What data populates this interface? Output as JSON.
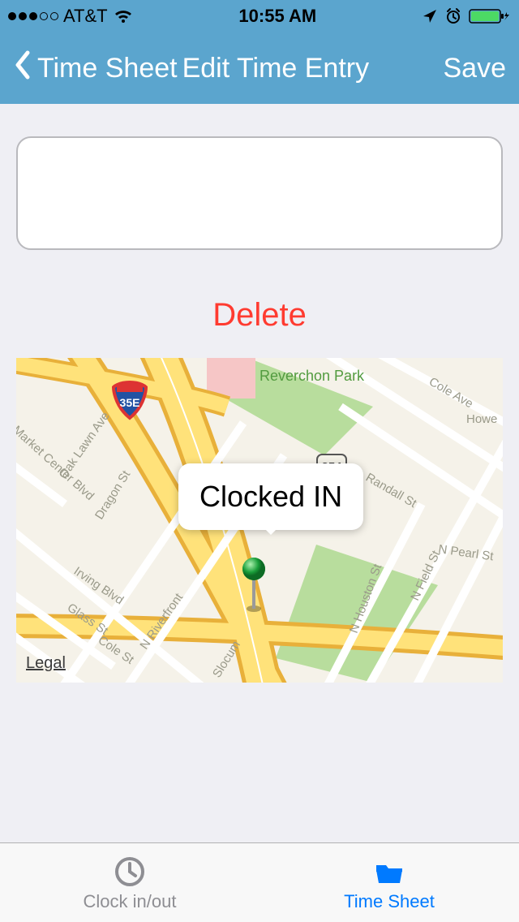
{
  "status": {
    "carrier": "AT&T",
    "time": "10:55 AM"
  },
  "nav": {
    "back_label": "Time Sheet",
    "title": "Edit Time Entry",
    "save_label": "Save"
  },
  "note": {
    "value": ""
  },
  "delete_label": "Delete",
  "map": {
    "callout_text": "Clocked IN",
    "legal_label": "Legal",
    "shield_route": "35E",
    "labels": {
      "park": "Reverchon Park",
      "cole_ave": "Cole Ave",
      "howe": "Howe",
      "randall": "Randall St",
      "npearl": "N Pearl St",
      "nfield": "N Field St",
      "nhouston": "N Houston St",
      "slocum": "Slocum",
      "cole_st": "Cole St",
      "glass": "Glass St",
      "irving": "Irving Blvd",
      "dragon": "Dragon St",
      "nriver": "N Riverfront",
      "oaklawn": "Oak Lawn Ave",
      "market": "Market Center Blvd"
    }
  },
  "tabs": {
    "clock_label": "Clock in/out",
    "timesheet_label": "Time Sheet"
  }
}
